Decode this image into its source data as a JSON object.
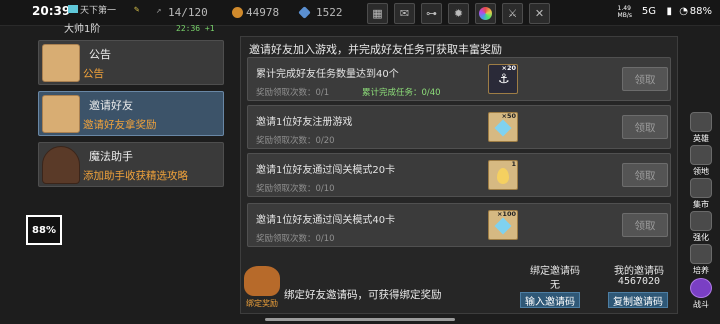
{
  "status_bar": {
    "time": "20:39",
    "player_title": "天下第一",
    "player_name": "大帅1阶",
    "network_speed": "1.49\nMB/s",
    "network_type": "5G",
    "battery": "88%"
  },
  "resources": {
    "exp_value": "14/120",
    "exp_sub": "22:36 +1",
    "gold": "44978",
    "gems": "1522"
  },
  "toolbar_icons": [
    "shop-icon",
    "mail-icon",
    "gamepad-icon",
    "settings-icon",
    "color-wheel-icon",
    "sword-icon",
    "tools-icon"
  ],
  "sidebar": {
    "items": [
      {
        "title": "公告",
        "subtitle": "公告",
        "icon": "letter-icon"
      },
      {
        "title": "邀请好友",
        "subtitle": "邀请好友拿奖励",
        "icon": "letter-icon"
      },
      {
        "title": "魔法助手",
        "subtitle": "添加助手收获精选攻略",
        "icon": "wizard-hat-icon"
      }
    ],
    "active_index": 1
  },
  "overlay_badge": "88%",
  "main": {
    "header": "邀请好友加入游戏，并完成好友任务可获取丰富奖励",
    "tasks": [
      {
        "title": "累计完成好友任务数量达到40个",
        "progress": "奖励领取次数：0/1",
        "extra": "累计完成任务：0/40",
        "reward_count": "×20",
        "reward_icon": "anchor-icon",
        "button": "领取"
      },
      {
        "title": "邀请1位好友注册游戏",
        "progress": "奖励领取次数：0/20",
        "extra": "",
        "reward_count": "×50",
        "reward_icon": "diamond-icon",
        "button": "领取"
      },
      {
        "title": "邀请1位好友通过闯关模式20卡",
        "progress": "奖励领取次数：0/10",
        "extra": "",
        "reward_count": "1",
        "reward_icon": "egg-icon",
        "button": "领取"
      },
      {
        "title": "邀请1位好友通过闯关模式40卡",
        "progress": "奖励领取次数：0/10",
        "extra": "",
        "reward_count": "×100",
        "reward_icon": "diamond-icon",
        "button": "领取"
      }
    ]
  },
  "footer": {
    "emblem_label": "绑定奖励",
    "bind_text": "绑定好友邀请码，可获得绑定奖励",
    "bound_code_label": "绑定邀请码",
    "bound_code_value": "无",
    "input_button": "输入邀请码",
    "my_code_label": "我的邀请码",
    "my_code_value": "4567020",
    "copy_button": "复制邀请码"
  },
  "side_nav": [
    {
      "label": "英雄",
      "icon": "hero-icon"
    },
    {
      "label": "领地",
      "icon": "territory-icon"
    },
    {
      "label": "集市",
      "icon": "market-icon"
    },
    {
      "label": "强化",
      "icon": "upgrade-icon"
    },
    {
      "label": "培养",
      "icon": "training-icon"
    },
    {
      "label": "战斗",
      "icon": "battle-icon"
    }
  ],
  "colors": {
    "accent_orange": "#f0a23b",
    "active_blue": "#3c5369",
    "progress_green": "#8ee07a"
  }
}
